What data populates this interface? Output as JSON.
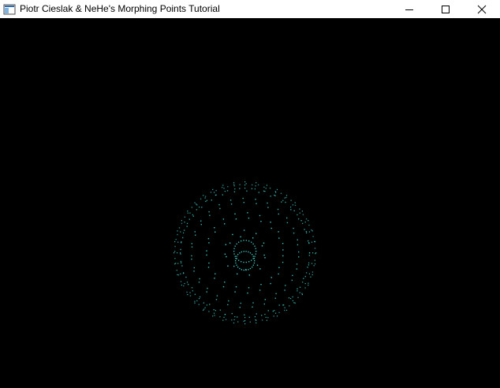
{
  "window": {
    "title": "Piotr Cieslak & NeHe's Morphing Points Tutorial",
    "icon": "app-window-icon",
    "controls": {
      "minimize_icon": "minimize-icon",
      "maximize_icon": "maximize-icon",
      "close_icon": "close-icon"
    }
  },
  "scene": {
    "background_color": "#000000",
    "point_color": "#3fd3c8",
    "shape": "morphing point sphere"
  }
}
